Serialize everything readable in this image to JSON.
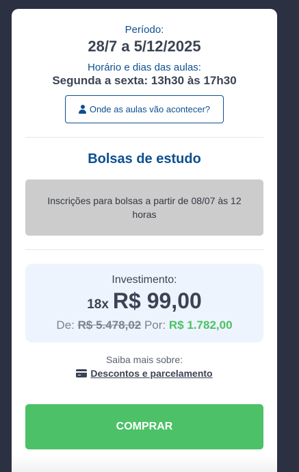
{
  "schedule": {
    "period_label": "Período:",
    "period_value": "28/7 a 5/12/2025",
    "times_label": "Horário e dias das aulas:",
    "times_value": "Segunda a sexta: 13h30 às 17h30",
    "location_button": "Onde as aulas vão acontecer?"
  },
  "scholarships": {
    "title": "Bolsas de estudo",
    "notice": "Inscrições para bolsas a partir de 08/07 às 12 horas"
  },
  "investment": {
    "label": "Investimento:",
    "installments": "18x",
    "installment_price": "R$ 99,00",
    "from_label": "De:",
    "old_price": "R$ 5.478,02",
    "to_label": "Por:",
    "new_price": "R$ 1.782,00"
  },
  "more_info": {
    "label": "Saiba mais sobre:",
    "link": "Descontos e parcelamento"
  },
  "buy_button": "COMPRAR",
  "colors": {
    "primary_blue": "#0d4e8f",
    "accent_green": "#4cc167",
    "background": "#2b3042"
  },
  "icons": {
    "location_button": "person-icon",
    "more_link": "credit-card-icon"
  }
}
